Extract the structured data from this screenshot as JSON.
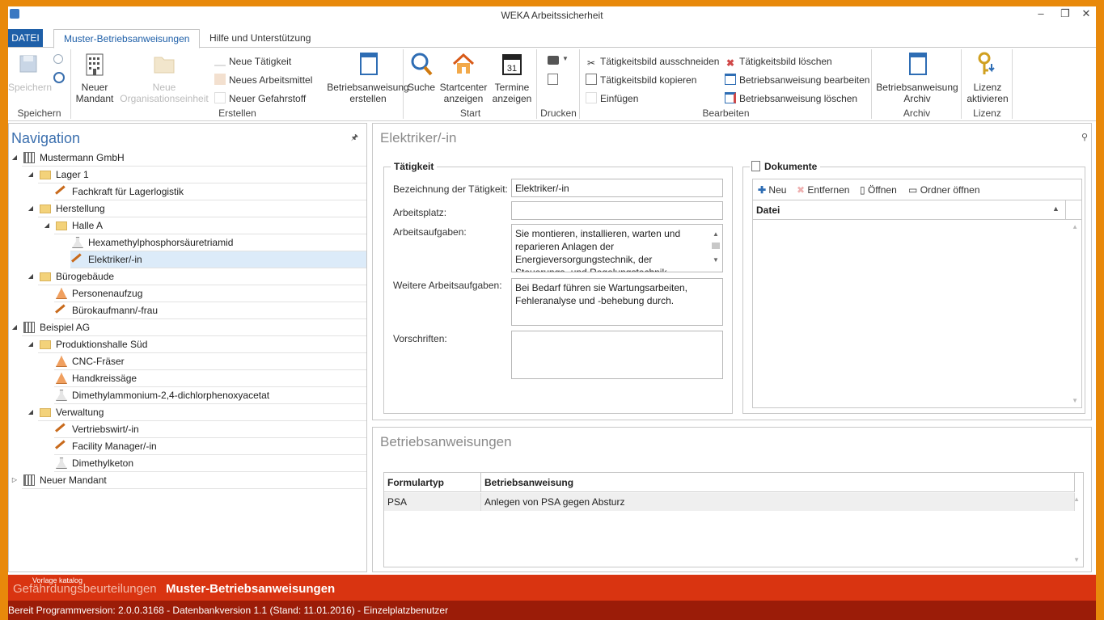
{
  "window": {
    "title": "WEKA Arbeitssicherheit",
    "minimize": "–",
    "restore": "❐",
    "close": "✕"
  },
  "tabs": {
    "file": "DATEI",
    "active": "Muster-Betriebsanweisungen",
    "help": "Hilfe und Unterstützung"
  },
  "ribbon": {
    "speichern": {
      "save": "Speichern",
      "group": "Speichern"
    },
    "erstellen": {
      "new_client": "Neuer Mandant",
      "new_org": "Neue Organisationseinheit",
      "new_activity": "Neue Tätigkeit",
      "new_workspace": "Neues Arbeitsmittel",
      "new_hazard": "Neuer Gefahrstoff",
      "create_ba": "Betriebsanweisung erstellen",
      "group": "Erstellen"
    },
    "start": {
      "search": "Suche",
      "startcenter": "Startcenter anzeigen",
      "dates": "Termine anzeigen",
      "group": "Start"
    },
    "drucken": {
      "group": "Drucken"
    },
    "bearbeiten": {
      "cut": "Tätigkeitsbild ausschneiden",
      "copy": "Tätigkeitsbild kopieren",
      "paste": "Einfügen",
      "delete_pic": "Tätigkeitsbild löschen",
      "edit_ba": "Betriebsanweisung bearbeiten",
      "delete_ba": "Betriebsanweisung löschen",
      "group": "Bearbeiten"
    },
    "archiv": {
      "archive": "Betriebsanweisung Archiv",
      "group": "Archiv"
    },
    "lizenz": {
      "activate": "Lizenz aktivieren",
      "group": "Lizenz"
    }
  },
  "navigation": {
    "title": "Navigation",
    "pin": "🖈",
    "items": [
      {
        "label": "Mustermann GmbH",
        "level": 0,
        "icon": "building-icon",
        "expander": "◢"
      },
      {
        "label": "Lager 1",
        "level": 1,
        "icon": "folder-icon",
        "expander": "◢"
      },
      {
        "label": "Fachkraft für Lagerlogistik",
        "level": 2,
        "icon": "hammer-icon",
        "expander": ""
      },
      {
        "label": "Herstellung",
        "level": 1,
        "icon": "folder-icon",
        "expander": "◢"
      },
      {
        "label": "Halle A",
        "level": 2,
        "icon": "folder-icon",
        "expander": "◢"
      },
      {
        "label": "Hexamethylphosphorsäuretriamid",
        "level": 3,
        "icon": "flask-icon",
        "expander": ""
      },
      {
        "label": "Elektriker/-in",
        "level": 3,
        "icon": "hammer-icon",
        "expander": ""
      },
      {
        "label": "Bürogebäude",
        "level": 1,
        "icon": "folder-icon",
        "expander": "◢"
      },
      {
        "label": "Personenaufzug",
        "level": 2,
        "icon": "machine-icon",
        "expander": ""
      },
      {
        "label": "Bürokaufmann/-frau",
        "level": 2,
        "icon": "hammer-icon",
        "expander": ""
      },
      {
        "label": "Beispiel AG",
        "level": 0,
        "icon": "building-icon",
        "expander": "◢"
      },
      {
        "label": "Produktionshalle Süd",
        "level": 1,
        "icon": "folder-icon",
        "expander": "◢"
      },
      {
        "label": "CNC-Fräser",
        "level": 2,
        "icon": "machine-icon",
        "expander": ""
      },
      {
        "label": "Handkreissäge",
        "level": 2,
        "icon": "machine-icon",
        "expander": ""
      },
      {
        "label": "Dimethylammonium-2,4-dichlorphenoxyacetat",
        "level": 2,
        "icon": "flask-icon",
        "expander": ""
      },
      {
        "label": "Verwaltung",
        "level": 1,
        "icon": "folder-icon",
        "expander": "◢"
      },
      {
        "label": "Vertriebswirt/-in",
        "level": 2,
        "icon": "hammer-icon",
        "expander": ""
      },
      {
        "label": "Facility Manager/-in",
        "level": 2,
        "icon": "hammer-icon",
        "expander": ""
      },
      {
        "label": "Dimethylketon",
        "level": 2,
        "icon": "flask-icon",
        "expander": ""
      },
      {
        "label": "Neuer Mandant",
        "level": 0,
        "icon": "building-icon",
        "expander": "▷"
      }
    ],
    "selected": "Elektriker/-in"
  },
  "detail": {
    "title": "Elektriker/-in",
    "activity": {
      "legend": "Tätigkeit",
      "name_label": "Bezeichnung der Tätigkeit:",
      "name_value": "Elektriker/-in",
      "workplace_label": "Arbeitsplatz:",
      "workplace_value": "",
      "tasks_label": "Arbeitsaufgaben:",
      "tasks_value": "Sie montieren, installieren, warten und reparieren Anlagen der Energieversorgungstechnik, der Steuerungs- und Regelungstechnik",
      "more_label": "Weitere Arbeitsaufgaben:",
      "more_value": "Bei Bedarf führen sie Wartungsarbeiten, Fehleranalyse und -behebung durch.",
      "rules_label": "Vorschriften:",
      "rules_value": ""
    },
    "documents": {
      "legend": "Dokumente",
      "new": "Neu",
      "remove": "Entfernen",
      "open": "Öffnen",
      "open_folder": "Ordner öffnen",
      "col_file": "Datei"
    }
  },
  "instructions": {
    "title": "Betriebsanweisungen",
    "col_type": "Formulartyp",
    "col_name": "Betriebsanweisung",
    "rows": [
      {
        "type": "PSA",
        "name": "Anlegen von PSA gegen Absturz"
      }
    ]
  },
  "bottom": {
    "caption": "Vorlage katalog",
    "tab_risk": "Gefährdungsbeurteilungen",
    "tab_active": "Muster-Betriebsanweisungen"
  },
  "status": "Bereit   Programmversion: 2.0.0.3168 - Datenbankversion 1.1 (Stand: 11.01.2016) - Einzelplatzbenutzer",
  "colors": {
    "accent": "#1e5fa8",
    "bottom_bar": "#d93411",
    "status_bar": "#9b1c08",
    "frame": "#e8890b"
  }
}
